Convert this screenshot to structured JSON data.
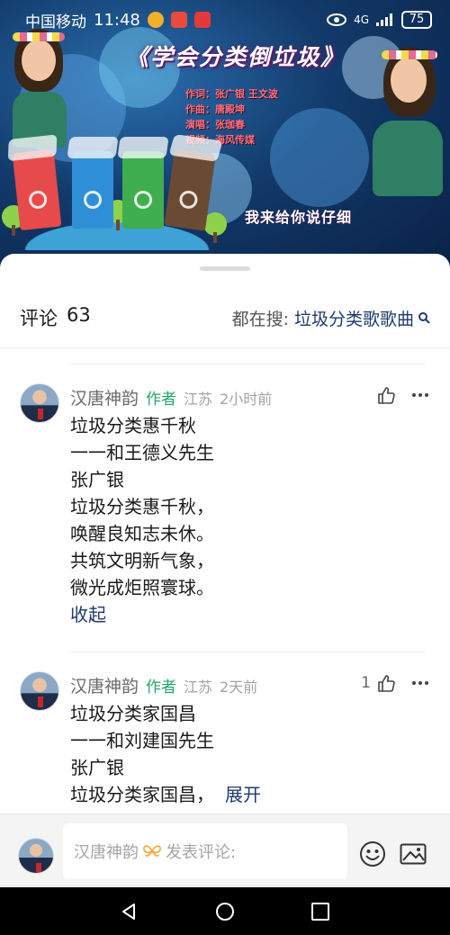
{
  "status_bar": {
    "carrier": "中国移动",
    "time": "11:48",
    "network": "4G",
    "battery": "75"
  },
  "video": {
    "title": "《学会分类倒垃圾》",
    "credits": [
      "作词：张广银 王文波",
      "作曲：唐殿坤",
      "演唱：张珈春",
      "视频：海风传媒"
    ],
    "tagline": "我来给你说仔细"
  },
  "comments_header": {
    "title": "评论",
    "count": "63",
    "search_prefix": "都在搜:",
    "search_term": "垃圾分类歌歌曲"
  },
  "comments": [
    {
      "author": "汉唐神韵",
      "author_tag": "作者",
      "location": "江苏",
      "time": "2小时前",
      "likes": "",
      "lines": [
        "垃圾分类惠千秋",
        "一一和王德义先生",
        "张广银",
        "垃圾分类惠千秋，",
        "唤醒良知志未休。",
        "共筑文明新气象，",
        "微光成炬照寰球。"
      ],
      "toggle": "收起"
    },
    {
      "author": "汉唐神韵",
      "author_tag": "作者",
      "location": "江苏",
      "time": "2天前",
      "likes": "1",
      "lines": [
        "垃圾分类家国昌",
        "一一和刘建国先生",
        "张广银",
        "垃圾分类家国昌，"
      ],
      "toggle": "展开"
    }
  ],
  "input_bar": {
    "placeholder_name": "汉唐神韵",
    "placeholder_text": "发表评论:"
  },
  "colors": {
    "link": "#1e3a6e",
    "author_tag": "#23a66b",
    "muted": "#a3a3a3"
  }
}
